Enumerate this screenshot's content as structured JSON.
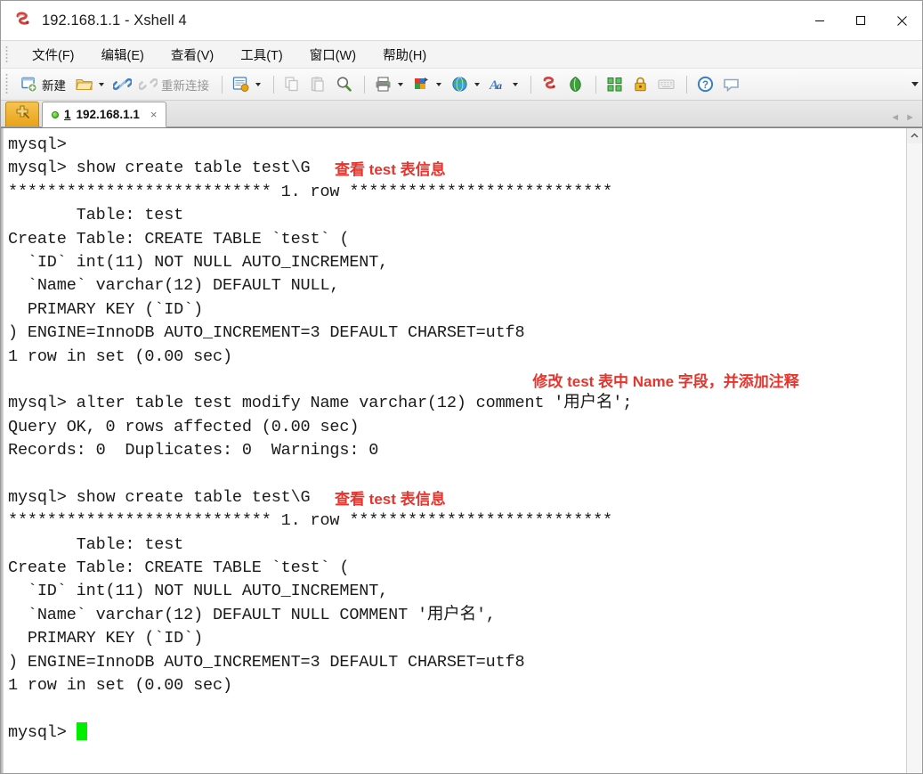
{
  "window": {
    "title": "192.168.1.1 - Xshell 4",
    "app_icon": "xshell-logo-icon",
    "controls": {
      "minimize": "minimize-icon",
      "maximize": "maximize-icon",
      "close": "close-icon"
    }
  },
  "menubar": {
    "items": [
      {
        "label": "文件(F)",
        "name": "menu-file"
      },
      {
        "label": "编辑(E)",
        "name": "menu-edit"
      },
      {
        "label": "查看(V)",
        "name": "menu-view"
      },
      {
        "label": "工具(T)",
        "name": "menu-tools"
      },
      {
        "label": "窗口(W)",
        "name": "menu-window"
      },
      {
        "label": "帮助(H)",
        "name": "menu-help"
      }
    ]
  },
  "toolbar": {
    "new_label": "新建",
    "reconnect_label": "重新连接",
    "overflow_icon": "chevron-down-icon",
    "buttons": [
      "new-session-button",
      "open-folder-button",
      "connect-button",
      "reconnect-button",
      "properties-button",
      "copy-button",
      "paste-button",
      "find-button",
      "print-button",
      "color-scheme-button",
      "globe-button",
      "font-button",
      "xshell-button",
      "xftp-button",
      "layout-button",
      "lock-button",
      "keyboard-button",
      "help-button",
      "feedback-button"
    ]
  },
  "tabbar": {
    "new_tab_icon": "new-tab-plus-icon",
    "tab": {
      "number": "1",
      "title": "192.168.1.1",
      "close": "×",
      "status": "connected"
    },
    "nav_left": "◄",
    "nav_right": "►"
  },
  "scrollbar": {
    "up_arrow": "chevron-up-icon"
  },
  "colors": {
    "annotation_red": "#e8342c",
    "cursor_green": "#00ee00",
    "terminal_bg": "#ffffff",
    "terminal_fg": "#1a1a1a",
    "tab_accent": "#e8a317"
  },
  "terminal": {
    "lines": [
      {
        "text": "mysql>"
      },
      {
        "text": "mysql> show create table test\\G",
        "note": "查看 test 表信息",
        "note_col": 33
      },
      {
        "text": "*************************** 1. row ***************************"
      },
      {
        "text": "       Table: test"
      },
      {
        "text": "Create Table: CREATE TABLE `test` ("
      },
      {
        "text": "  `ID` int(11) NOT NULL AUTO_INCREMENT,"
      },
      {
        "text": "  `Name` varchar(12) DEFAULT NULL,"
      },
      {
        "text": "  PRIMARY KEY (`ID`)"
      },
      {
        "text": ") ENGINE=InnoDB AUTO_INCREMENT=3 DEFAULT CHARSET=utf8"
      },
      {
        "text": "1 row in set (0.00 sec)"
      },
      {
        "text": "",
        "note": "修改 test 表中 Name 字段，并添加注释",
        "note_col": 53
      },
      {
        "text": "mysql> alter table test modify Name varchar(12) comment '用户名';"
      },
      {
        "text": "Query OK, 0 rows affected (0.00 sec)"
      },
      {
        "text": "Records: 0  Duplicates: 0  Warnings: 0"
      },
      {
        "text": ""
      },
      {
        "text": "mysql> show create table test\\G",
        "note": "查看 test 表信息",
        "note_col": 33
      },
      {
        "text": "*************************** 1. row ***************************"
      },
      {
        "text": "       Table: test"
      },
      {
        "text": "Create Table: CREATE TABLE `test` ("
      },
      {
        "text": "  `ID` int(11) NOT NULL AUTO_INCREMENT,"
      },
      {
        "text": "  `Name` varchar(12) DEFAULT NULL COMMENT '用户名',"
      },
      {
        "text": "  PRIMARY KEY (`ID`)"
      },
      {
        "text": ") ENGINE=InnoDB AUTO_INCREMENT=3 DEFAULT CHARSET=utf8"
      },
      {
        "text": "1 row in set (0.00 sec)"
      },
      {
        "text": ""
      },
      {
        "text": "mysql> ",
        "cursor": true
      }
    ]
  }
}
